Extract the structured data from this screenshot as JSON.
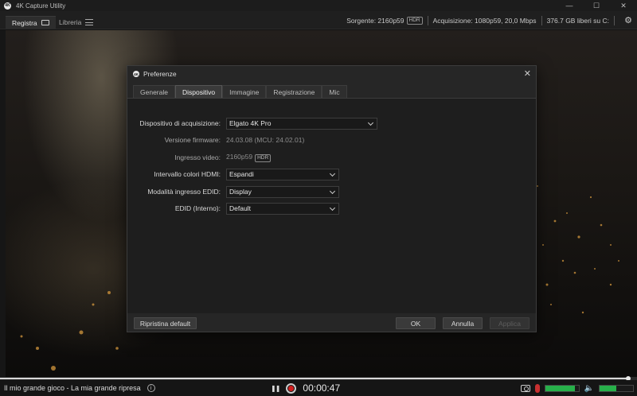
{
  "app": {
    "title": "4K Capture Utility",
    "icon_text": "4K"
  },
  "window_controls": {
    "minimize": "—",
    "maximize": "☐",
    "close": "✕"
  },
  "tabs": {
    "record": "Registra",
    "library": "Libreria"
  },
  "status": {
    "source": "Sorgente: 2160p59",
    "source_badge": "HDR",
    "acquisition": "Acquisizione: 1080p59, 20,0 Mbps",
    "free_space": "376.7 GB liberi su C:"
  },
  "dialog": {
    "title": "Preferenze",
    "icon_text": "4K",
    "close": "✕",
    "tabs": [
      "Generale",
      "Dispositivo",
      "Immagine",
      "Registrazione",
      "Mic"
    ],
    "active_tab": 1,
    "fields": {
      "device_label": "Dispositivo di acquisizione:",
      "device_value": "Elgato 4K Pro",
      "firmware_label": "Versione firmware:",
      "firmware_value": "24.03.08 (MCU: 24.02.01)",
      "video_input_label": "Ingresso video:",
      "video_input_value": "2160p59",
      "video_input_badge": "HDR",
      "hdmi_range_label": "Intervallo colori HDMI:",
      "hdmi_range_value": "Espandi",
      "edid_mode_label": "Modalità ingresso EDID:",
      "edid_mode_value": "Display",
      "edid_label": "EDID (Interno):",
      "edid_value": "Default"
    },
    "buttons": {
      "reset": "Ripristina default",
      "ok": "OK",
      "cancel": "Annulla",
      "apply": "Applica"
    }
  },
  "bottom": {
    "clip_title": "Il mio grande gioco - La mia grande ripresa",
    "info_icon": "i",
    "pause_icon": "❚❚",
    "timer": "00:00:47",
    "speaker_icon": "🔈"
  },
  "levels": {
    "seek_progress": 0.988,
    "mic_level": 0.88,
    "speaker_level": 0.5
  },
  "colors": {
    "record_red": "#d21e1e",
    "meter_green": "#27b04a",
    "mic_muted_red": "#c83030"
  }
}
